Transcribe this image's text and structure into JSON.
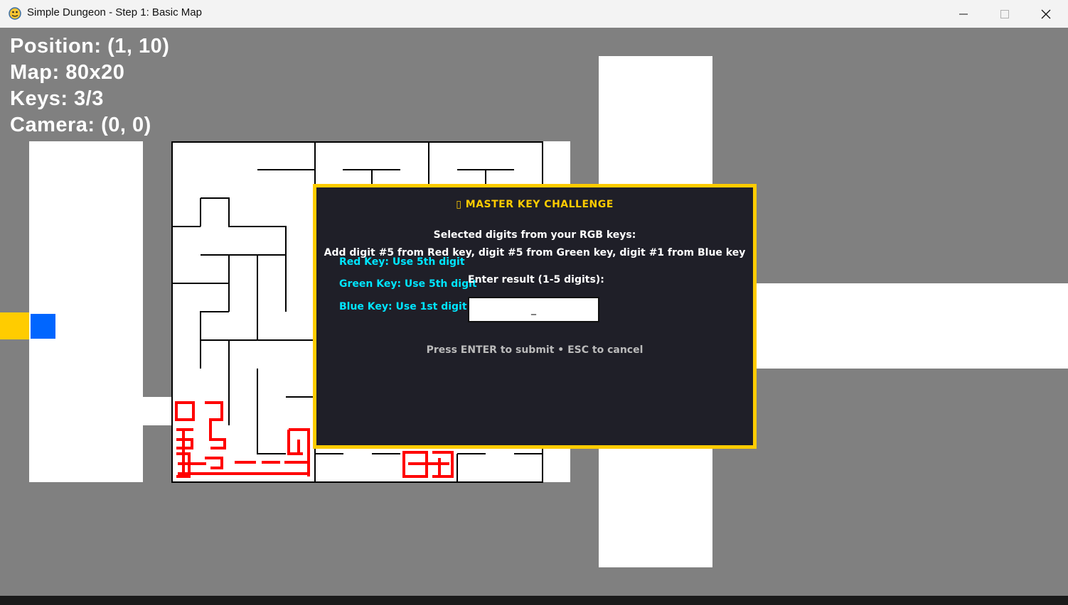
{
  "window": {
    "title": "Simple Dungeon - Step 1: Basic Map",
    "icon": "python-snake-icon",
    "controls": [
      "minimize-icon",
      "maximize-icon",
      "close-icon"
    ]
  },
  "hud": {
    "position": "Position: (1, 10)",
    "map": "Map: 80x20",
    "keys": "Keys: 3/3",
    "camera": "Camera: (0, 0)"
  },
  "dialog": {
    "title": "▯ MASTER KEY CHALLENGE",
    "subtitle": "Selected digits from your RGB keys:",
    "formula": "Add digit #5 from Red key, digit #5 from Green key, digit #1 from Blue key",
    "hints": {
      "red": "Red Key: Use 5th digit",
      "green": "Green Key: Use 5th digit",
      "blue": "Blue Key: Use 1st digit"
    },
    "prompt": "Enter result (1-5 digits):",
    "input_value": "_",
    "footer": "Press ENTER to submit • ESC to cancel"
  },
  "colors": {
    "background": "#808080",
    "room": "#ffffff",
    "maze_wall": "#000000",
    "trap": "#ff0000",
    "dialog_border": "#ffcc00",
    "dialog_bg": "#1f1f28",
    "hint_text": "#00e5ff",
    "player": "#0066ff",
    "key_tile": "#ffcc00"
  }
}
